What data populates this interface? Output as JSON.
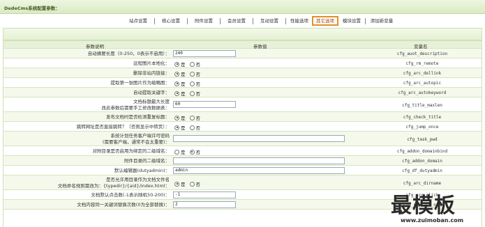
{
  "header": {
    "title": "DedeCms系统配置参数："
  },
  "tabs": [
    {
      "label": "站点设置",
      "active": false
    },
    {
      "label": "核心设置",
      "active": false
    },
    {
      "label": "附件设置",
      "active": false
    },
    {
      "label": "会员设置",
      "active": false
    },
    {
      "label": "互动设置",
      "active": false
    },
    {
      "label": "性能选项",
      "active": false
    },
    {
      "label": "其它选项",
      "active": true
    },
    {
      "label": "模块设置",
      "active": false
    },
    {
      "label": "添加新变量",
      "active": false
    }
  ],
  "table": {
    "headers": {
      "desc": "参数说明",
      "value": "参数值",
      "key": "变量名"
    },
    "radio_labels": {
      "yes": "是",
      "no": "否"
    },
    "rows": [
      {
        "label": "自动摘要长度（0-250，0表示不启用）：",
        "type": "text",
        "value": "240",
        "key": "cfg_auot_description"
      },
      {
        "label": "远程图片本地化：",
        "type": "radio",
        "checked": "yes",
        "key": "cfg_rm_remote"
      },
      {
        "label": "删除非站内链接：",
        "type": "radio",
        "checked": "yes",
        "key": "cfg_arc_dellink"
      },
      {
        "label": "提取第一张图片作为缩略图：",
        "type": "radio",
        "checked": "yes",
        "key": "cfg_arc_autopic"
      },
      {
        "label": "自动提取关键字：",
        "type": "radio",
        "checked": "yes",
        "key": "cfg_arc_autokeyword"
      },
      {
        "label": "文档标题最大长度",
        "label2": "改此参数后需要手工修改数据表：",
        "type": "text",
        "value": "60",
        "key": "cfg_title_maxlen"
      },
      {
        "label": "发布文档时是否检测重复标题：",
        "type": "radio",
        "checked": "yes",
        "key": "cfg_check_title"
      },
      {
        "label": "跳转网址是否直接跳转？（否则显示中转页）：",
        "type": "radio",
        "checked": "yes",
        "key": "cfg_jump_once"
      },
      {
        "label": "系统计划任务客户端许可密码",
        "label2": "(需要客户端，通常不会太重要)：",
        "type": "text",
        "value": "",
        "key": "cfg_task_pwd"
      },
      {
        "label": "对附目录是否启用为绑定的二级域名：",
        "type": "radio",
        "checked": "no",
        "key": "cfg_addon_domainbind"
      },
      {
        "label": "附件目录的二级域名：",
        "type": "text",
        "value": "",
        "key": "cfg_addon_domain"
      },
      {
        "label": "默认编辑器(dutyadmin)：",
        "type": "text",
        "value": "admin",
        "key": "cfg_df_dutyadmin"
      },
      {
        "label": "是否允许用目录作为文档文件名",
        "label2": "文档命名规则需改为：{typedir}/{aid}/index.html：",
        "type": "radio",
        "checked": "yes",
        "key": "cfg_arc_dirname"
      },
      {
        "label": "文档默认点击数(-1表示随机50-200)：",
        "type": "text",
        "value": "-1",
        "key": "cfg_arc_click"
      },
      {
        "label": "文档内容同一关键词替换次数(0为全部替换)：",
        "type": "text",
        "value": "2",
        "key": "cfg_replace_num"
      }
    ]
  },
  "watermark": {
    "text": "最模板",
    "url": "www.zuimoban.com"
  }
}
